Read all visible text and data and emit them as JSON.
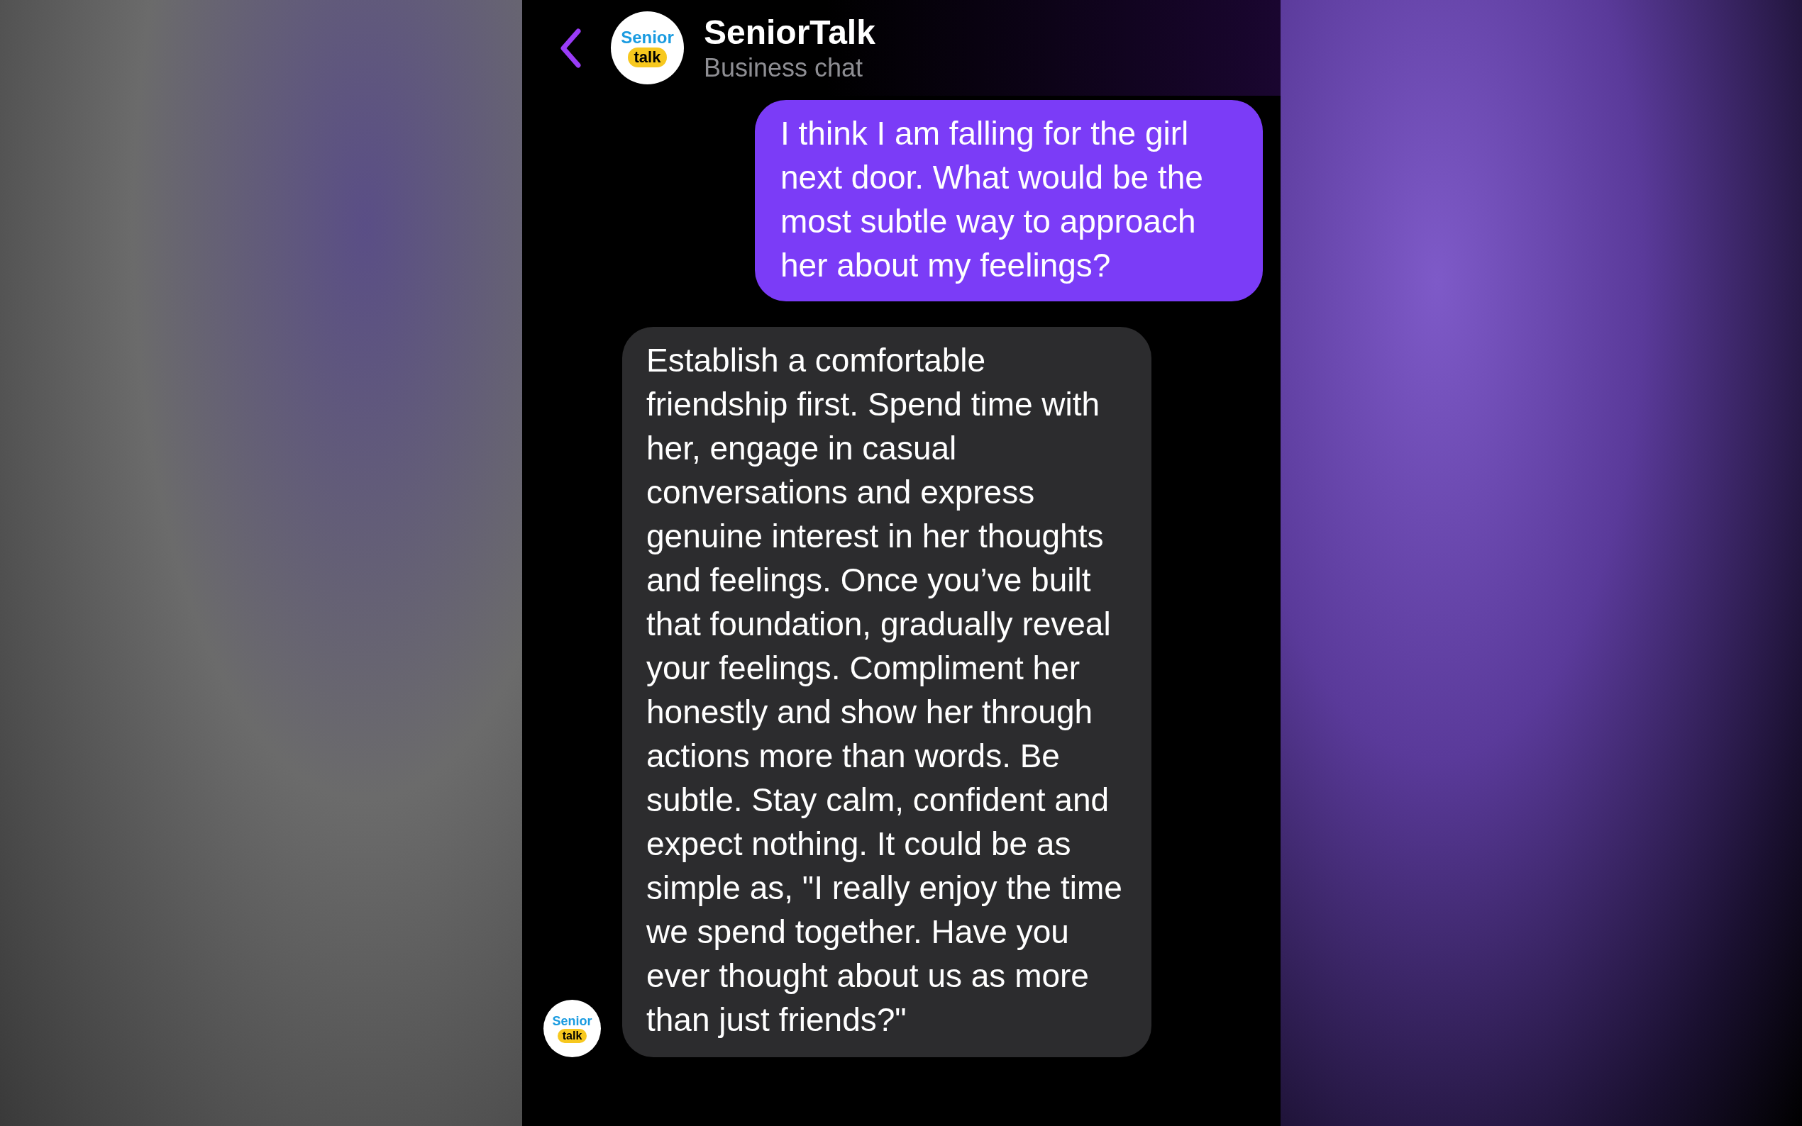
{
  "header": {
    "title": "SeniorTalk",
    "subtitle": "Business chat",
    "avatar": {
      "logo_top": "Senior",
      "logo_bottom": "talk"
    }
  },
  "messages": [
    {
      "kind": "sent",
      "text": "I think I am falling for the girl next door. What would be the most subtle way to approach her about my feelings?"
    },
    {
      "kind": "received",
      "text": "Establish a comfortable friendship first. Spend time with her, engage in casual conversations and express genuine interest in her thoughts and feelings. Once you’ve built that foundation, gradually reveal your feelings. Compliment her honestly and show her through actions more than words. Be subtle. Stay calm, confident and expect nothing. It could be as simple as, \"I really enjoy the time we spend together. Have you ever thought about us as more than just friends?\"",
      "avatar": {
        "logo_top": "Senior",
        "logo_bottom": "talk"
      }
    }
  ]
}
